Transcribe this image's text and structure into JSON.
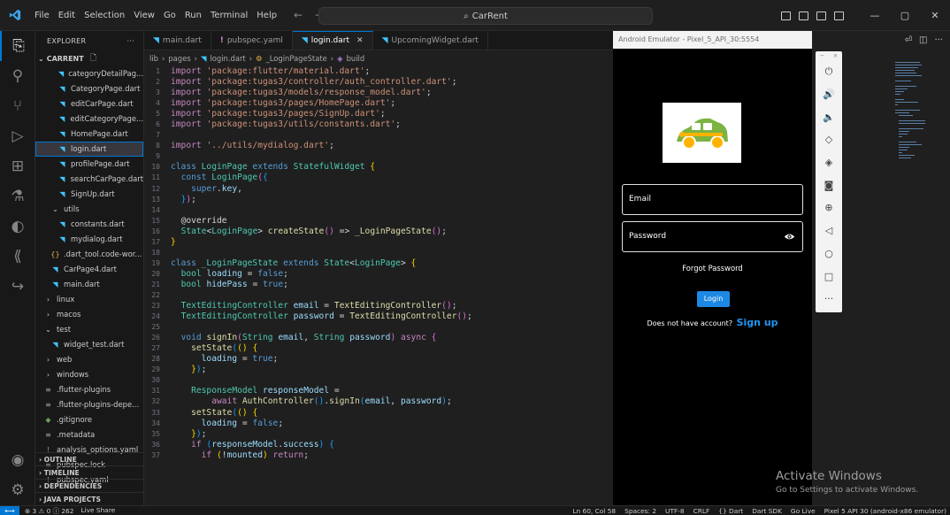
{
  "titlebar": {
    "menus": [
      "File",
      "Edit",
      "Selection",
      "View",
      "Go",
      "Run",
      "Terminal",
      "Help"
    ],
    "search_text": "CarRent"
  },
  "sidebar": {
    "header": "EXPLORER",
    "header_more": "···",
    "project": "CARRENT",
    "items": [
      {
        "label": "categoryDetailPag...",
        "icon": "dart",
        "indent": 2
      },
      {
        "label": "CategoryPage.dart",
        "icon": "dart",
        "indent": 2
      },
      {
        "label": "editCarPage.dart",
        "icon": "dart",
        "indent": 2
      },
      {
        "label": "editCategoryPage...",
        "icon": "dart",
        "indent": 2
      },
      {
        "label": "HomePage.dart",
        "icon": "dart",
        "indent": 2
      },
      {
        "label": "login.dart",
        "icon": "dart",
        "indent": 2,
        "selected": true
      },
      {
        "label": "profilePage.dart",
        "icon": "dart",
        "indent": 2
      },
      {
        "label": "searchCarPage.dart",
        "icon": "dart",
        "indent": 2
      },
      {
        "label": "SignUp.dart",
        "icon": "dart",
        "indent": 2
      },
      {
        "label": "utils",
        "icon": "chevron-down",
        "indent": 1
      },
      {
        "label": "constants.dart",
        "icon": "dart",
        "indent": 2
      },
      {
        "label": "mydialog.dart",
        "icon": "dart",
        "indent": 2
      },
      {
        "label": ".dart_tool.code-wor...",
        "icon": "braces",
        "indent": 1
      },
      {
        "label": "CarPage4.dart",
        "icon": "dart",
        "indent": 1
      },
      {
        "label": "main.dart",
        "icon": "dart",
        "indent": 1
      },
      {
        "label": "linux",
        "icon": "chevron-right",
        "indent": 0
      },
      {
        "label": "macos",
        "icon": "chevron-right",
        "indent": 0
      },
      {
        "label": "test",
        "icon": "chevron-down",
        "indent": 0
      },
      {
        "label": "widget_test.dart",
        "icon": "dart",
        "indent": 1
      },
      {
        "label": "web",
        "icon": "chevron-right",
        "indent": 0
      },
      {
        "label": "windows",
        "icon": "chevron-right",
        "indent": 0
      },
      {
        "label": ".flutter-plugins",
        "icon": "lines",
        "indent": 0
      },
      {
        "label": ".flutter-plugins-depe...",
        "icon": "lines",
        "indent": 0
      },
      {
        "label": ".gitignore",
        "icon": "dot",
        "indent": 0
      },
      {
        "label": ".metadata",
        "icon": "lines",
        "indent": 0
      },
      {
        "label": "analysis_options.yaml",
        "icon": "yaml",
        "indent": 0
      },
      {
        "label": "pubspec.lock",
        "icon": "lines",
        "indent": 0
      },
      {
        "label": "pubspec.yaml",
        "icon": "yaml",
        "indent": 0
      }
    ],
    "sections": [
      "OUTLINE",
      "TIMELINE",
      "DEPENDENCIES",
      "JAVA PROJECTS"
    ]
  },
  "tabs": [
    {
      "label": "main.dart",
      "icon": "dart"
    },
    {
      "label": "pubspec.yaml",
      "icon": "yaml"
    },
    {
      "label": "login.dart",
      "icon": "dart",
      "active": true
    },
    {
      "label": "UpcomingWidget.dart",
      "icon": "dart"
    }
  ],
  "breadcrumb": [
    "lib",
    "pages",
    "login.dart",
    "_LoginPageState",
    "build"
  ],
  "code_lines": [
    {
      "n": "1",
      "t": [
        [
          "kw",
          "import "
        ],
        [
          "str",
          "'package:flutter/material.dart'"
        ],
        [
          "pn",
          ";"
        ]
      ]
    },
    {
      "n": "2",
      "t": [
        [
          "kw",
          "import "
        ],
        [
          "str",
          "'package:tugas3/controller/auth_controller.dart'"
        ],
        [
          "pn",
          ";"
        ]
      ]
    },
    {
      "n": "3",
      "t": [
        [
          "kw",
          "import "
        ],
        [
          "str",
          "'package:tugas3/models/response_model.dart'"
        ],
        [
          "pn",
          ";"
        ]
      ]
    },
    {
      "n": "4",
      "t": [
        [
          "kw",
          "import "
        ],
        [
          "str",
          "'package:tugas3/pages/HomePage.dart'"
        ],
        [
          "pn",
          ";"
        ]
      ]
    },
    {
      "n": "5",
      "t": [
        [
          "kw",
          "import "
        ],
        [
          "str",
          "'package:tugas3/pages/SignUp.dart'"
        ],
        [
          "pn",
          ";"
        ]
      ]
    },
    {
      "n": "6",
      "t": [
        [
          "kw",
          "import "
        ],
        [
          "str",
          "'package:tugas3/utils/constants.dart'"
        ],
        [
          "pn",
          ";"
        ]
      ]
    },
    {
      "n": "7",
      "t": []
    },
    {
      "n": "8",
      "t": [
        [
          "kw",
          "import "
        ],
        [
          "str",
          "'../utils/mydialog.dart'"
        ],
        [
          "pn",
          ";"
        ]
      ]
    },
    {
      "n": "9",
      "t": []
    },
    {
      "n": "10",
      "t": [
        [
          "kw2",
          "class "
        ],
        [
          "ty",
          "LoginPage "
        ],
        [
          "kw2",
          "extends "
        ],
        [
          "ty",
          "StatefulWidget "
        ],
        [
          "br1",
          "{"
        ]
      ]
    },
    {
      "n": "11",
      "t": [
        [
          "pn",
          "  "
        ],
        [
          "kw2",
          "const "
        ],
        [
          "ty",
          "LoginPage"
        ],
        [
          "br2",
          "("
        ],
        [
          "br3",
          "{"
        ]
      ]
    },
    {
      "n": "12",
      "t": [
        [
          "pn",
          "    "
        ],
        [
          "kw2",
          "super"
        ],
        [
          "pn",
          "."
        ],
        [
          "va",
          "key"
        ],
        [
          "pn",
          ","
        ]
      ]
    },
    {
      "n": "13",
      "t": [
        [
          "pn",
          "  "
        ],
        [
          "br3",
          "}"
        ],
        [
          "br2",
          ")"
        ],
        [
          "pn",
          ";"
        ]
      ]
    },
    {
      "n": "14",
      "t": []
    },
    {
      "n": "15",
      "t": [
        [
          "pn",
          "  "
        ],
        [
          "an",
          "@override"
        ]
      ]
    },
    {
      "n": "16",
      "t": [
        [
          "pn",
          "  "
        ],
        [
          "ty",
          "State"
        ],
        [
          "pn",
          "<"
        ],
        [
          "ty",
          "LoginPage"
        ],
        [
          "pn",
          "> "
        ],
        [
          "fn",
          "createState"
        ],
        [
          "br2",
          "()"
        ],
        [
          "pn",
          " => "
        ],
        [
          "fn",
          "_LoginPageState"
        ],
        [
          "br2",
          "()"
        ],
        [
          "pn",
          ";"
        ]
      ]
    },
    {
      "n": "17",
      "t": [
        [
          "br1",
          "}"
        ]
      ]
    },
    {
      "n": "18",
      "t": []
    },
    {
      "n": "19",
      "t": [
        [
          "kw2",
          "class "
        ],
        [
          "ty",
          "_LoginPageState "
        ],
        [
          "kw2",
          "extends "
        ],
        [
          "ty",
          "State"
        ],
        [
          "pn",
          "<"
        ],
        [
          "ty",
          "LoginPage"
        ],
        [
          "pn",
          "> "
        ],
        [
          "br1",
          "{"
        ]
      ]
    },
    {
      "n": "20",
      "t": [
        [
          "pn",
          "  "
        ],
        [
          "ty",
          "bool "
        ],
        [
          "va",
          "loading"
        ],
        [
          "pn",
          " = "
        ],
        [
          "kw2",
          "false"
        ],
        [
          "pn",
          ";"
        ]
      ]
    },
    {
      "n": "21",
      "t": [
        [
          "pn",
          "  "
        ],
        [
          "ty",
          "bool "
        ],
        [
          "va",
          "hidePass"
        ],
        [
          "pn",
          " = "
        ],
        [
          "kw2",
          "true"
        ],
        [
          "pn",
          ";"
        ]
      ]
    },
    {
      "n": "22",
      "t": []
    },
    {
      "n": "23",
      "t": [
        [
          "pn",
          "  "
        ],
        [
          "ty",
          "TextEditingController "
        ],
        [
          "va",
          "email"
        ],
        [
          "pn",
          " = "
        ],
        [
          "fn",
          "TextEditingController"
        ],
        [
          "br2",
          "()"
        ],
        [
          "pn",
          ";"
        ]
      ]
    },
    {
      "n": "24",
      "t": [
        [
          "pn",
          "  "
        ],
        [
          "ty",
          "TextEditingController "
        ],
        [
          "va",
          "password"
        ],
        [
          "pn",
          " = "
        ],
        [
          "fn",
          "TextEditingController"
        ],
        [
          "br2",
          "()"
        ],
        [
          "pn",
          ";"
        ]
      ]
    },
    {
      "n": "25",
      "t": []
    },
    {
      "n": "26",
      "t": [
        [
          "pn",
          "  "
        ],
        [
          "kw2",
          "void "
        ],
        [
          "fn",
          "signIn"
        ],
        [
          "br2",
          "("
        ],
        [
          "ty",
          "String "
        ],
        [
          "va",
          "email"
        ],
        [
          "pn",
          ", "
        ],
        [
          "ty",
          "String "
        ],
        [
          "va",
          "password"
        ],
        [
          "br2",
          ")"
        ],
        [
          "kw",
          " async "
        ],
        [
          "br2",
          "{"
        ]
      ]
    },
    {
      "n": "27",
      "t": [
        [
          "pn",
          "    "
        ],
        [
          "fn",
          "setState"
        ],
        [
          "br3",
          "("
        ],
        [
          "br1",
          "()"
        ],
        [
          "pn",
          " "
        ],
        [
          "br1",
          "{"
        ]
      ]
    },
    {
      "n": "28",
      "t": [
        [
          "pn",
          "      "
        ],
        [
          "va",
          "loading"
        ],
        [
          "pn",
          " = "
        ],
        [
          "kw2",
          "true"
        ],
        [
          "pn",
          ";"
        ]
      ]
    },
    {
      "n": "29",
      "t": [
        [
          "pn",
          "    "
        ],
        [
          "br1",
          "}"
        ],
        [
          "br3",
          ")"
        ],
        [
          "pn",
          ";"
        ]
      ]
    },
    {
      "n": "30",
      "t": []
    },
    {
      "n": "31",
      "t": [
        [
          "pn",
          "    "
        ],
        [
          "ty",
          "ResponseModel "
        ],
        [
          "va",
          "responseModel"
        ],
        [
          "pn",
          " ="
        ]
      ]
    },
    {
      "n": "32",
      "t": [
        [
          "pn",
          "        "
        ],
        [
          "kw",
          "await "
        ],
        [
          "fn",
          "AuthController"
        ],
        [
          "br3",
          "()"
        ],
        [
          "pn",
          "."
        ],
        [
          "fn",
          "signIn"
        ],
        [
          "br3",
          "("
        ],
        [
          "va",
          "email"
        ],
        [
          "pn",
          ", "
        ],
        [
          "va",
          "password"
        ],
        [
          "br3",
          ")"
        ],
        [
          "pn",
          ";"
        ]
      ]
    },
    {
      "n": "33",
      "t": [
        [
          "pn",
          "    "
        ],
        [
          "fn",
          "setState"
        ],
        [
          "br3",
          "("
        ],
        [
          "br1",
          "()"
        ],
        [
          "pn",
          " "
        ],
        [
          "br1",
          "{"
        ]
      ]
    },
    {
      "n": "34",
      "t": [
        [
          "pn",
          "      "
        ],
        [
          "va",
          "loading"
        ],
        [
          "pn",
          " = "
        ],
        [
          "kw2",
          "false"
        ],
        [
          "pn",
          ";"
        ]
      ]
    },
    {
      "n": "35",
      "t": [
        [
          "pn",
          "    "
        ],
        [
          "br1",
          "}"
        ],
        [
          "br3",
          ")"
        ],
        [
          "pn",
          ";"
        ]
      ]
    },
    {
      "n": "36",
      "t": [
        [
          "pn",
          "    "
        ],
        [
          "kw",
          "if "
        ],
        [
          "br3",
          "("
        ],
        [
          "va",
          "responseModel"
        ],
        [
          "pn",
          "."
        ],
        [
          "va",
          "success"
        ],
        [
          "br3",
          ")"
        ],
        [
          "pn",
          " "
        ],
        [
          "br3",
          "{"
        ]
      ]
    },
    {
      "n": "37",
      "t": [
        [
          "pn",
          "      "
        ],
        [
          "kw",
          "if "
        ],
        [
          "br1",
          "("
        ],
        [
          "pn",
          "!"
        ],
        [
          "va",
          "mounted"
        ],
        [
          "br1",
          ")"
        ],
        [
          "kw",
          " return"
        ],
        [
          "pn",
          ";"
        ]
      ]
    }
  ],
  "emulator": {
    "title": "Android Emulator - Pixel_5_API_30:5554",
    "email_label": "Email",
    "password_label": "Password",
    "forgot": "Forgot Password",
    "login": "Login",
    "no_account": "Does not have account?",
    "signup": "Sign up",
    "toolbar_top": [
      "−",
      "×"
    ],
    "toolbar_buttons": [
      "power-icon",
      "volume-up-icon",
      "volume-down-icon",
      "rotate-left-icon",
      "rotate-right-icon",
      "camera-icon",
      "zoom-icon",
      "back-icon",
      "home-icon",
      "overview-icon",
      "more-icon"
    ]
  },
  "watermark": {
    "line1": "Activate Windows",
    "line2": "Go to Settings to activate Windows."
  },
  "statusbar": {
    "problems": "⊗ 3 ⚠ 0 ⓘ 262",
    "live_share": "Live Share",
    "right_items": [
      "Ln 60, Col 58",
      "Spaces: 2",
      "UTF-8",
      "CRLF",
      "{} Dart",
      "Dart SDK",
      "Go Live",
      "Pixel 5 API 30 (android-x86 emulator)"
    ]
  }
}
